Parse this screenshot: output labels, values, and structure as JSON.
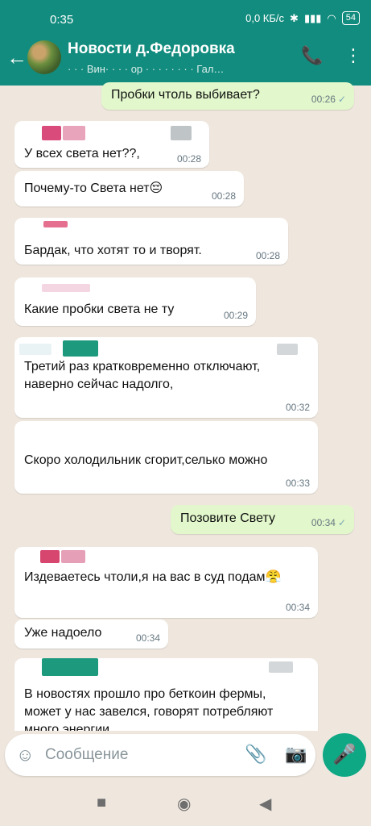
{
  "status": {
    "time": "0:35",
    "speed": "0,0 КБ/с",
    "battery": "54"
  },
  "header": {
    "title": "Новости д.Федоровка",
    "subtitle": "· · · Вин· · · · ор ·  · ·   ·  ·  · · · Гал…"
  },
  "messages": [
    {
      "dir": "out",
      "text": "Пробки чтоль  выбивает?",
      "time": "00:26"
    },
    {
      "dir": "in",
      "text": "У всех света нет??,",
      "time": "00:28"
    },
    {
      "dir": "in",
      "text": "Почему-то Света нет😔",
      "time": "00:28"
    },
    {
      "dir": "in",
      "text": "Бардак, что хотят то и творят.",
      "time": "00:28"
    },
    {
      "dir": "in",
      "text": "Какие пробки света не ту",
      "time": "00:29"
    },
    {
      "dir": "in",
      "text": "Третий раз кратковременно отключают, наверно сейчас надолго,",
      "time": "00:32"
    },
    {
      "dir": "in",
      "text": "Скоро холодильник  сгорит,селько можно",
      "time": "00:33"
    },
    {
      "dir": "out",
      "text": "Позовите Свету",
      "time": "00:34"
    },
    {
      "dir": "in",
      "text": "Издеваетесь чтоли,я на вас в суд подам😤",
      "time": "00:34"
    },
    {
      "dir": "in",
      "text": "Уже надоело",
      "time": "00:34"
    },
    {
      "dir": "in",
      "text": "В новостях прошло про беткоин фермы, может у нас завелся, говорят потребляют много энергии",
      "time": ""
    }
  ],
  "input": {
    "placeholder": "Сообщение"
  },
  "colors": {
    "header": "#128c7e",
    "outgoing": "#e2f7cb",
    "mic": "#0fa884"
  }
}
